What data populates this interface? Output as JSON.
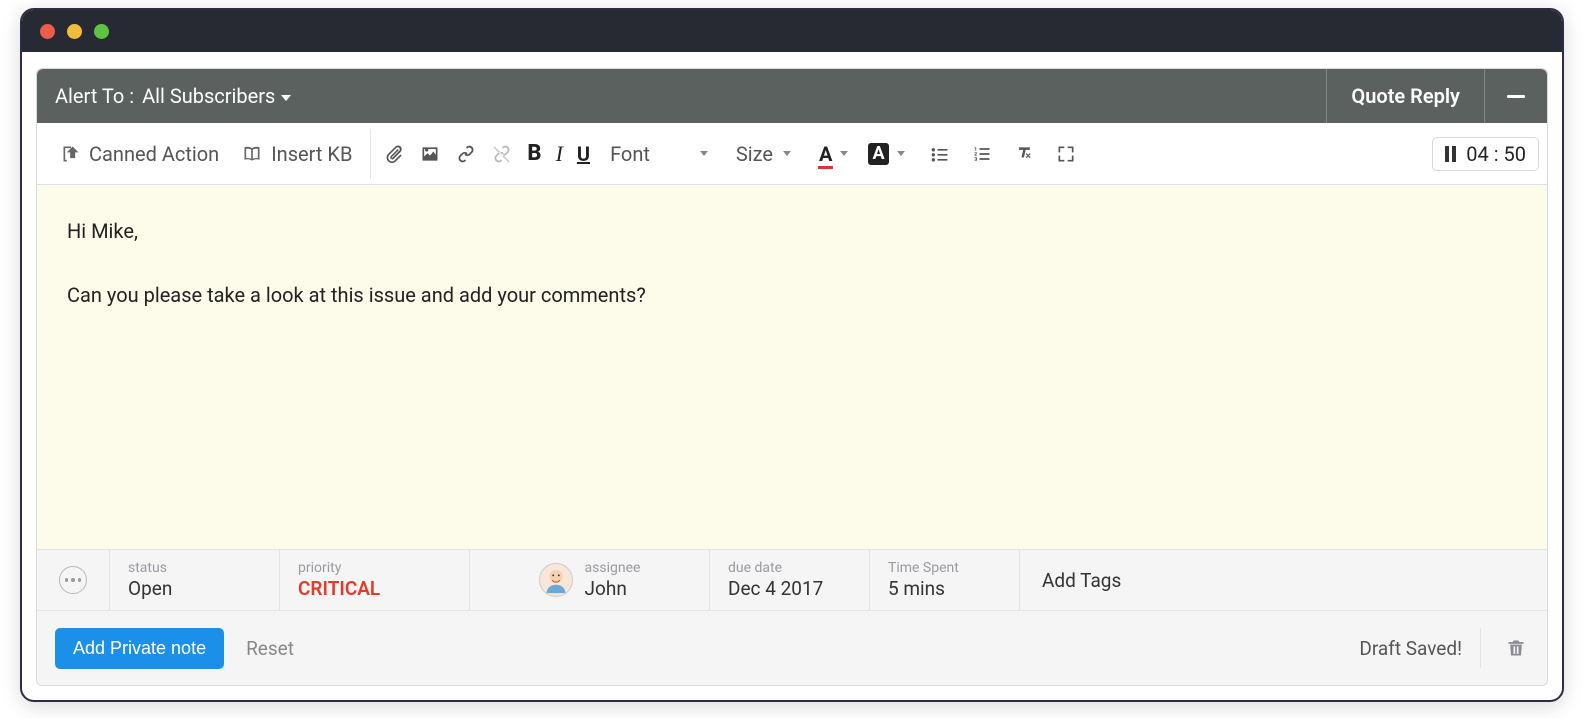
{
  "header": {
    "alert_label": "Alert To :",
    "alert_value": "All Subscribers",
    "quote_reply": "Quote Reply"
  },
  "toolbar": {
    "canned_action": "Canned Action",
    "insert_kb": "Insert KB",
    "font_label": "Font",
    "size_label": "Size",
    "timer": "04 : 50",
    "bold_glyph": "B",
    "italic_glyph": "I",
    "underline_glyph": "U",
    "text_color_glyph": "A",
    "highlight_glyph": "A"
  },
  "editor": {
    "line1": "Hi Mike,",
    "line2": "Can you please take a look at this issue and add your comments?"
  },
  "meta": {
    "status": {
      "label": "status",
      "value": "Open"
    },
    "priority": {
      "label": "priority",
      "value": "CRITICAL"
    },
    "assignee": {
      "label": "assignee",
      "value": "John"
    },
    "due_date": {
      "label": "due date",
      "value": "Dec 4 2017"
    },
    "time_spent": {
      "label": "Time Spent",
      "value": "5 mins"
    },
    "tags_placeholder": "Add Tags"
  },
  "footer": {
    "add_note": "Add Private note",
    "reset": "Reset",
    "draft_saved": "Draft Saved!"
  },
  "colors": {
    "accent": "#1c90e8",
    "critical": "#e43a2b",
    "header_bg": "#5a615e",
    "editor_bg": "#fdfbe9"
  }
}
